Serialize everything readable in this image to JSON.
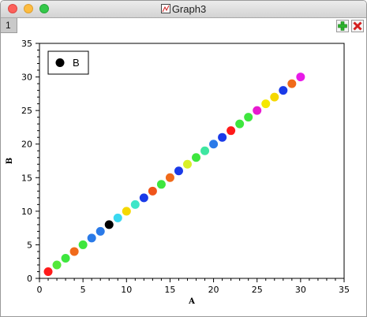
{
  "window": {
    "title": "Graph3"
  },
  "tabs": [
    {
      "label": "1"
    }
  ],
  "toolbar": {
    "add_icon": "plus-icon",
    "delete_icon": "close-icon"
  },
  "chart_data": {
    "type": "scatter",
    "title": "",
    "xlabel": "A",
    "ylabel": "B",
    "xlim": [
      0,
      35
    ],
    "ylim": [
      0,
      35
    ],
    "xticks": [
      "0",
      "5",
      "10",
      "15",
      "20",
      "25",
      "30",
      "35"
    ],
    "yticks": [
      "0",
      "5",
      "10",
      "15",
      "20",
      "25",
      "30",
      "35"
    ],
    "grid": false,
    "legend": {
      "position": "top-left",
      "entries": [
        {
          "label": "B",
          "color": "#000000"
        }
      ]
    },
    "series": [
      {
        "name": "B",
        "x": [
          1,
          2,
          3,
          4,
          5,
          6,
          7,
          8,
          9,
          10,
          11,
          12,
          13,
          14,
          15,
          16,
          17,
          18,
          19,
          20,
          21,
          22,
          23,
          24,
          25,
          26,
          27,
          28,
          29,
          30
        ],
        "y": [
          1,
          2,
          3,
          4,
          5,
          6,
          7,
          8,
          9,
          10,
          11,
          12,
          13,
          14,
          15,
          16,
          17,
          18,
          19,
          20,
          21,
          22,
          23,
          24,
          25,
          26,
          27,
          28,
          29,
          30
        ],
        "colors": [
          "#ff1a1a",
          "#55e83a",
          "#3ee63e",
          "#f06a1a",
          "#3ee63e",
          "#2a7ae8",
          "#2a7ae8",
          "#000000",
          "#3ad8f0",
          "#f5d800",
          "#3ee6c8",
          "#1a3ae8",
          "#f0541a",
          "#3ee63e",
          "#f06a1a",
          "#1a3ae8",
          "#d8f028",
          "#3ee63e",
          "#3ee6a0",
          "#2a7ae8",
          "#1a3ae8",
          "#ff1a1a",
          "#3ee63e",
          "#3ee63e",
          "#e81ad0",
          "#f5e800",
          "#f5d800",
          "#1a3ae8",
          "#f06a1a",
          "#e81ae8"
        ]
      }
    ]
  }
}
